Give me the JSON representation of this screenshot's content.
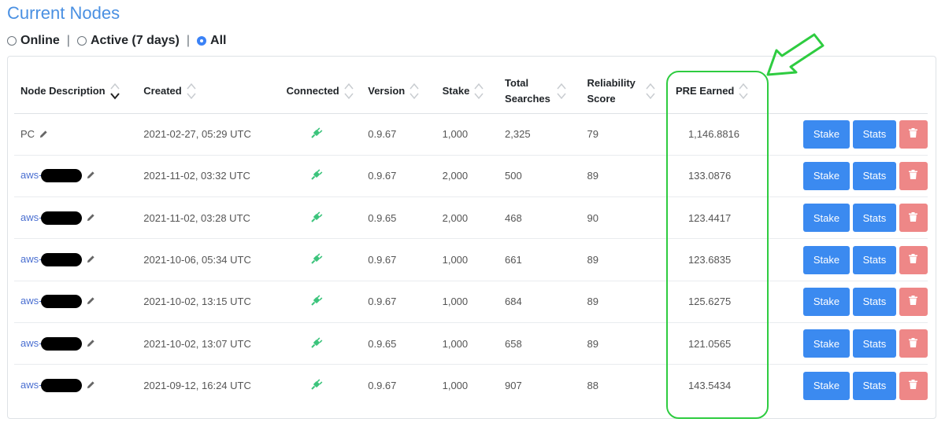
{
  "page": {
    "title": "Current Nodes"
  },
  "filters": {
    "options": [
      {
        "label": "Online",
        "checked": false
      },
      {
        "label": "Active (7 days)",
        "checked": false
      },
      {
        "label": "All",
        "checked": true
      }
    ],
    "separator": "|"
  },
  "table": {
    "columns": [
      {
        "label": "Node Description",
        "sort": "desc"
      },
      {
        "label": "Created",
        "sort": "none"
      },
      {
        "label": "Connected",
        "sort": "none"
      },
      {
        "label": "Version",
        "sort": "none"
      },
      {
        "label": "Stake",
        "sort": "none"
      },
      {
        "label": "Total Searches",
        "sort": "none"
      },
      {
        "label": "Reliability Score",
        "sort": "none"
      },
      {
        "label": "PRE Earned",
        "sort": "none"
      }
    ],
    "rows": [
      {
        "name": "PC",
        "redacted": false,
        "created": "2021-02-27, 05:29 UTC",
        "version": "0.9.67",
        "stake": "1,000",
        "searches": "2,325",
        "reliability": "79",
        "earned": "1,146.8816"
      },
      {
        "name": "aws-",
        "redacted": true,
        "created": "2021-11-02, 03:32 UTC",
        "version": "0.9.67",
        "stake": "2,000",
        "searches": "500",
        "reliability": "89",
        "earned": "133.0876"
      },
      {
        "name": "aws-",
        "redacted": true,
        "created": "2021-11-02, 03:28 UTC",
        "version": "0.9.65",
        "stake": "2,000",
        "searches": "468",
        "reliability": "90",
        "earned": "123.4417"
      },
      {
        "name": "aws-",
        "redacted": true,
        "created": "2021-10-06, 05:34 UTC",
        "version": "0.9.67",
        "stake": "1,000",
        "searches": "661",
        "reliability": "89",
        "earned": "123.6835"
      },
      {
        "name": "aws-",
        "redacted": true,
        "created": "2021-10-02, 13:15 UTC",
        "version": "0.9.67",
        "stake": "1,000",
        "searches": "684",
        "reliability": "89",
        "earned": "125.6275"
      },
      {
        "name": "aws-",
        "redacted": true,
        "created": "2021-10-02, 13:07 UTC",
        "version": "0.9.65",
        "stake": "1,000",
        "searches": "658",
        "reliability": "89",
        "earned": "121.0565"
      },
      {
        "name": "aws-",
        "redacted": true,
        "created": "2021-09-12, 16:24 UTC",
        "version": "0.9.67",
        "stake": "1,000",
        "searches": "907",
        "reliability": "88",
        "earned": "143.5434"
      }
    ],
    "actions": {
      "stake_label": "Stake",
      "stats_label": "Stats",
      "delete_icon": "trash-icon"
    }
  },
  "icons": {
    "edit": "pencil-icon",
    "connected": "plug-icon",
    "sort": "sort-icon"
  },
  "colors": {
    "title": "#4a90e2",
    "primary_button": "#3b8af0",
    "danger_button": "#ee8787",
    "connected_icon": "#3cc47c",
    "annotation": "#2ecc40",
    "link": "#4a6fd1"
  }
}
